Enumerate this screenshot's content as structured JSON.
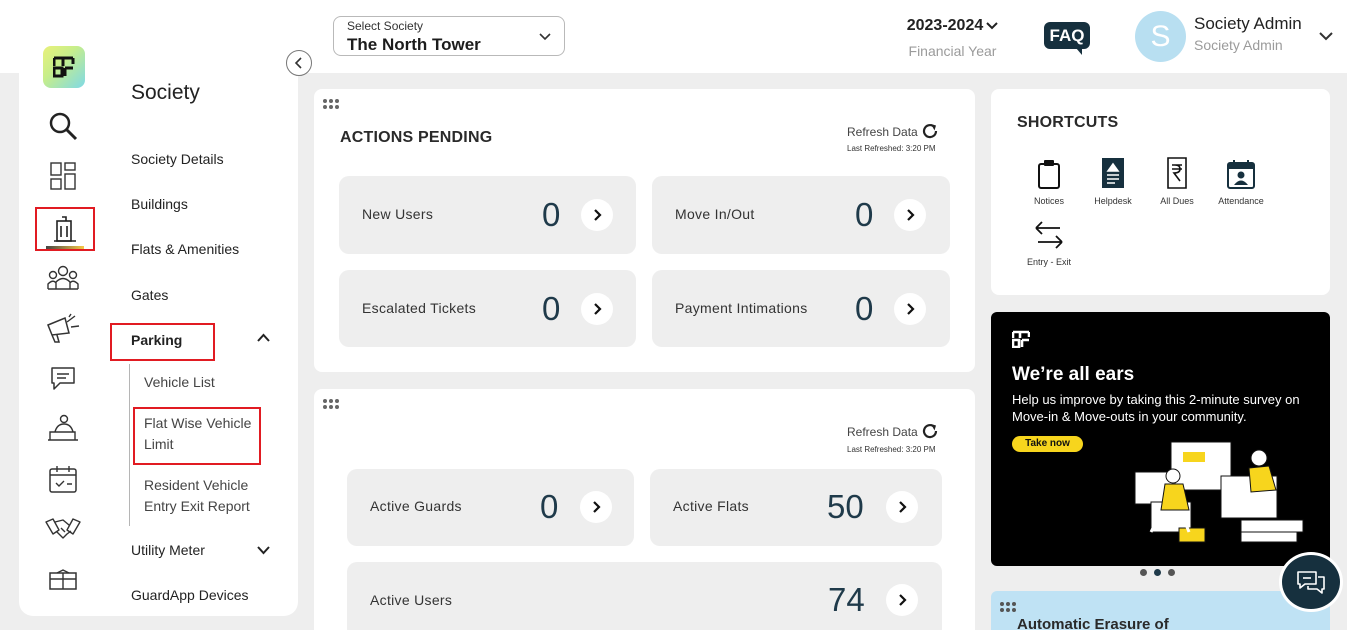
{
  "header": {
    "society_select": {
      "label": "Select Society",
      "value": "The North Tower"
    },
    "financial_year": {
      "value": "2023-2024",
      "label": "Financial Year"
    },
    "faq_label": "FAQ",
    "user": {
      "initial": "S",
      "name": "Society Admin",
      "role": "Society Admin"
    }
  },
  "sidebar": {
    "rail_icons": [
      "app-logo",
      "search-icon",
      "dashboard-grid-icon",
      "building-icon",
      "residents-icon",
      "announcement-icon",
      "chat-icon",
      "service-icon",
      "calendar-icon",
      "handshake-icon",
      "package-icon"
    ],
    "title": "Society",
    "items": [
      {
        "label": "Society Details"
      },
      {
        "label": "Buildings"
      },
      {
        "label": "Flats & Amenities"
      },
      {
        "label": "Gates"
      },
      {
        "label": "Parking"
      },
      {
        "label": "Utility Meter"
      },
      {
        "label": "GuardApp Devices"
      }
    ],
    "parking_sub": [
      {
        "label": "Vehicle List"
      },
      {
        "label": "Flat Wise Vehicle Limit"
      },
      {
        "label": "Resident Vehicle Entry Exit Report"
      }
    ]
  },
  "actions_pending": {
    "title": "ACTIONS PENDING",
    "refresh_label": "Refresh Data",
    "last_refreshed": "Last Refreshed: 3:20 PM",
    "stats": [
      {
        "label": "New Users",
        "value": "0"
      },
      {
        "label": "Move In/Out",
        "value": "0"
      },
      {
        "label": "Escalated Tickets",
        "value": "0"
      },
      {
        "label": "Payment Intimations",
        "value": "0"
      }
    ]
  },
  "overview": {
    "refresh_label": "Refresh Data",
    "last_refreshed": "Last Refreshed: 3:20 PM",
    "stats": [
      {
        "label": "Active Guards",
        "value": "0"
      },
      {
        "label": "Active Flats",
        "value": "50"
      },
      {
        "label": "Active Users",
        "value": "74"
      }
    ]
  },
  "shortcuts": {
    "title": "SHORTCUTS",
    "items": [
      {
        "label": "Notices",
        "icon": "clipboard-icon"
      },
      {
        "label": "Helpdesk",
        "icon": "helpdesk-icon"
      },
      {
        "label": "All Dues",
        "icon": "rupee-bill-icon"
      },
      {
        "label": "Attendance",
        "icon": "attendance-icon"
      },
      {
        "label": "Entry - Exit",
        "icon": "entry-exit-icon"
      }
    ]
  },
  "promo": {
    "title": "We’re all ears",
    "body": "Help us improve by taking this 2-minute survey on Move-in & Move-outs in your community.",
    "cta": "Take now",
    "accent": "#f7d51d"
  },
  "erasure": {
    "title": "Automatic Erasure of"
  },
  "colors": {
    "brand_dark": "#16303e",
    "highlight": "#e11b22",
    "accent_yellow": "#f7d51d"
  }
}
